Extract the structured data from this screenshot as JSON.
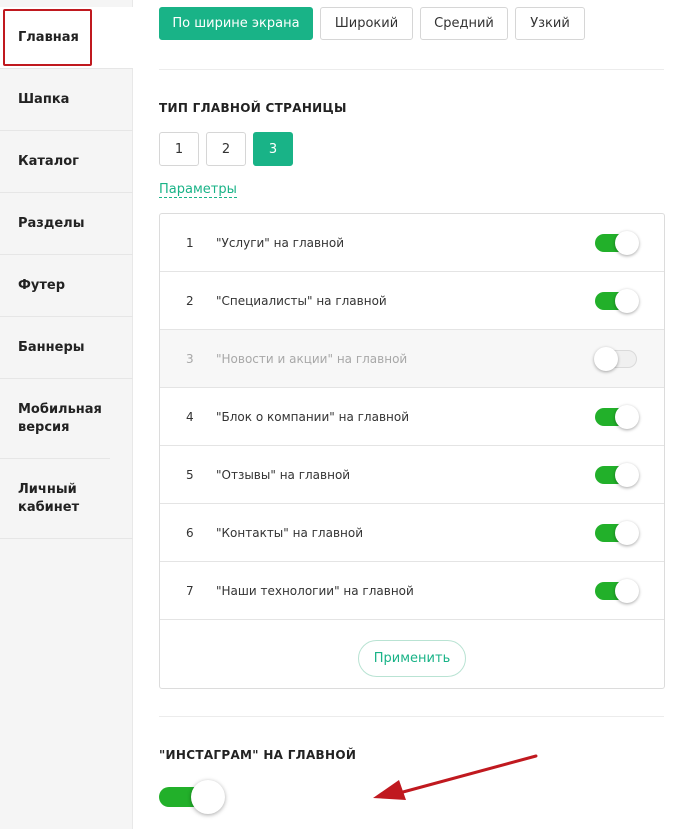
{
  "sidebar": {
    "items": [
      {
        "label": "Главная"
      },
      {
        "label": "Шапка"
      },
      {
        "label": "Каталог"
      },
      {
        "label": "Разделы"
      },
      {
        "label": "Футер"
      },
      {
        "label": "Баннеры"
      },
      {
        "label": "Мобильная версия"
      },
      {
        "label": "Личный кабинет"
      }
    ],
    "active_index": 0
  },
  "width_options": {
    "items": [
      {
        "label": "По ширине экрана"
      },
      {
        "label": "Широкий"
      },
      {
        "label": "Средний"
      },
      {
        "label": "Узкий"
      }
    ],
    "selected_index": 0
  },
  "home_type": {
    "title": "Тип главной страницы",
    "options": [
      {
        "label": "1"
      },
      {
        "label": "2"
      },
      {
        "label": "3"
      }
    ],
    "selected_index": 2
  },
  "params_link": "Параметры",
  "blocks": [
    {
      "num": "1",
      "label": "\"Услуги\" на главной",
      "enabled": true
    },
    {
      "num": "2",
      "label": "\"Специалисты\" на главной",
      "enabled": true
    },
    {
      "num": "3",
      "label": "\"Новости и акции\" на главной",
      "enabled": false
    },
    {
      "num": "4",
      "label": "\"Блок о компании\" на главной",
      "enabled": true
    },
    {
      "num": "5",
      "label": "\"Отзывы\" на главной",
      "enabled": true
    },
    {
      "num": "6",
      "label": "\"Контакты\" на главной",
      "enabled": true
    },
    {
      "num": "7",
      "label": "\"Наши технологии\" на главной",
      "enabled": true
    }
  ],
  "apply_label": "Применить",
  "instagram": {
    "title": "\"Инстаграм\" на главной",
    "enabled": true
  },
  "colors": {
    "accent": "#19b387",
    "toggle_on": "#22b02a",
    "highlight": "#c0191f"
  }
}
